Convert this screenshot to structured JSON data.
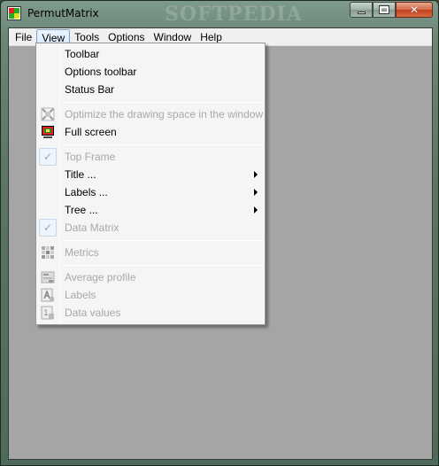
{
  "window": {
    "title": "PermutMatrix",
    "watermark": "SOFTPEDIA"
  },
  "menubar": {
    "items": [
      "File",
      "View",
      "Tools",
      "Options",
      "Window",
      "Help"
    ],
    "open_menu": "View"
  },
  "view_menu": {
    "items": [
      {
        "label": "Toolbar",
        "enabled": true
      },
      {
        "label": "Options toolbar",
        "enabled": true
      },
      {
        "label": "Status Bar",
        "enabled": true
      },
      {
        "label": "Optimize the drawing space in the window",
        "enabled": false,
        "icon": "optimize-icon"
      },
      {
        "label": "Full screen",
        "enabled": true,
        "icon": "fullscreen-icon"
      },
      {
        "label": "Top Frame",
        "enabled": false,
        "checked": true
      },
      {
        "label": "Title ...",
        "enabled": true,
        "submenu": true
      },
      {
        "label": "Labels ...",
        "enabled": true,
        "submenu": true
      },
      {
        "label": "Tree ...",
        "enabled": true,
        "submenu": true
      },
      {
        "label": "Data Matrix",
        "enabled": false,
        "checked": true
      },
      {
        "label": "Metrics",
        "enabled": false,
        "icon": "metrics-icon"
      },
      {
        "label": "Average profile",
        "enabled": false,
        "icon": "average-profile-icon"
      },
      {
        "label": "Labels",
        "enabled": false,
        "icon": "labels-icon"
      },
      {
        "label": "Data values",
        "enabled": false,
        "icon": "data-values-icon"
      }
    ]
  },
  "colors": {
    "mdi_background": "#a5a5a5",
    "menu_background": "#f5f5f5",
    "disabled_text": "#a8a8a8",
    "close_button": "#c0401e"
  }
}
